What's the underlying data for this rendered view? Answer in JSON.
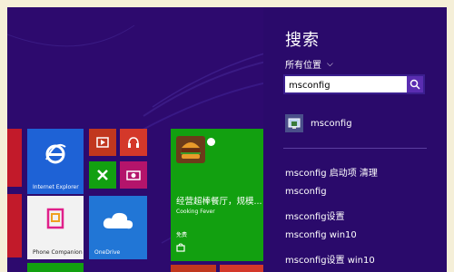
{
  "search": {
    "title": "搜索",
    "scope_label": "所有位置",
    "query": "msconfig",
    "top_result": "msconfig",
    "suggestions": [
      "msconfig 启动项 清理",
      "msconfig",
      "msconfig设置",
      "msconfig win10",
      "msconfig设置 win10"
    ]
  },
  "tiles": {
    "internet_explorer": "Internet Explorer",
    "phone_companion": "Phone Companion",
    "onedrive": "OneDrive",
    "cooking_fever_promo": "经营超棒餐厅，规模...",
    "cooking_fever_name": "Cooking Fever",
    "cooking_fever_price": "免费"
  },
  "colors": {
    "background": "#2d0a6e",
    "ie_tile": "#1e62d6",
    "green_tile": "#12a010",
    "red_tile": "#c1371e",
    "onedrive_tile": "#2176d6"
  },
  "icons": {
    "search_button": "magnifier-icon",
    "ie": "internet-explorer-icon",
    "phone": "phone-companion-icon",
    "onedrive": "cloud-icon",
    "store": "store-icon"
  }
}
